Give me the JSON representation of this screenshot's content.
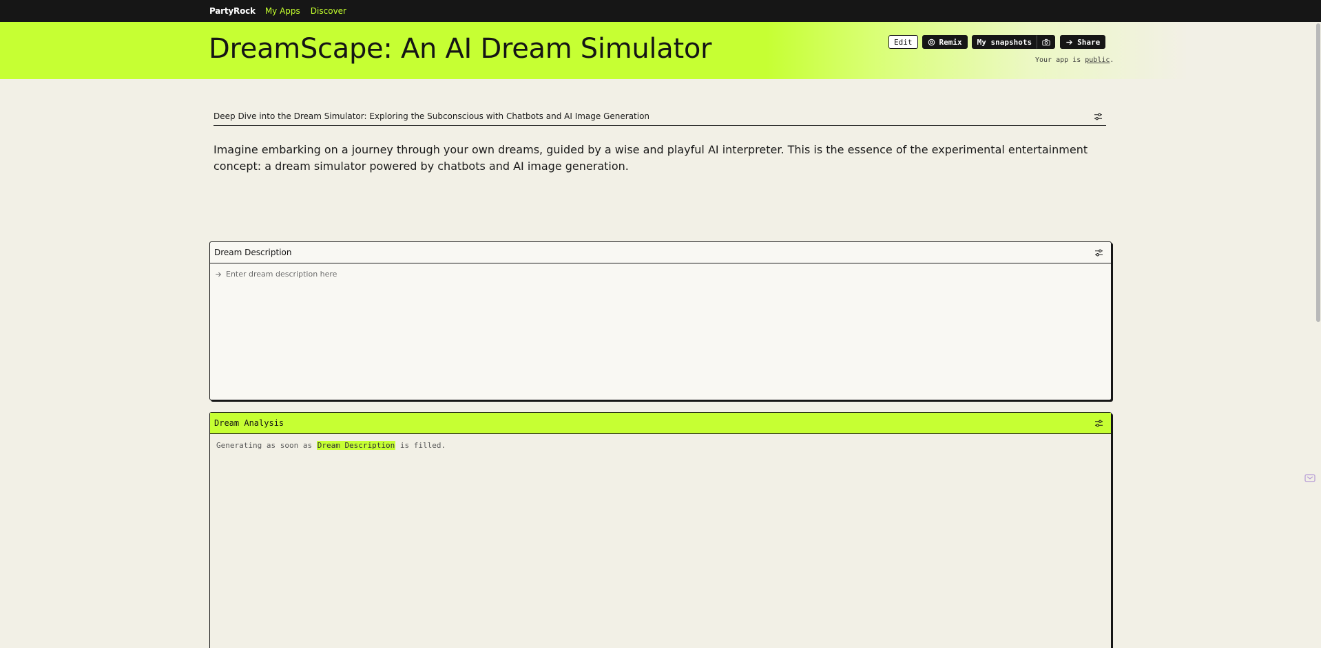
{
  "nav": {
    "brand": "PartyRock",
    "links": [
      "My Apps",
      "Discover"
    ]
  },
  "header": {
    "title": "DreamScape: An AI Dream Simulator",
    "buttons": {
      "edit": "Edit",
      "remix": "Remix",
      "snapshots": "My snapshots",
      "share": "Share"
    },
    "public_prefix": "Your app is",
    "public_link": "public",
    "public_suffix": "."
  },
  "intro": {
    "heading": "Deep Dive into the Dream Simulator: Exploring the Subconscious with Chatbots and AI Image Generation",
    "body": "Imagine embarking on a journey through your own dreams, guided by a wise and playful AI interpreter. This is the essence of the experimental entertainment concept: a dream simulator powered by chatbots and AI image generation."
  },
  "dream_description": {
    "label": "Dream Description",
    "placeholder": "Enter dream description here",
    "value": ""
  },
  "dream_analysis": {
    "label": "Dream Analysis",
    "status_prefix": "Generating as soon as",
    "status_ref": "Dream Description",
    "status_suffix": "is filled."
  },
  "colors": {
    "accent": "#c6ff33",
    "nav_bg": "#161616",
    "page_bg": "#f2f0e6"
  },
  "icons": [
    "remix-icon",
    "camera-icon",
    "share-arrow-icon",
    "settings-sliders-icon",
    "arrow-right-icon"
  ]
}
